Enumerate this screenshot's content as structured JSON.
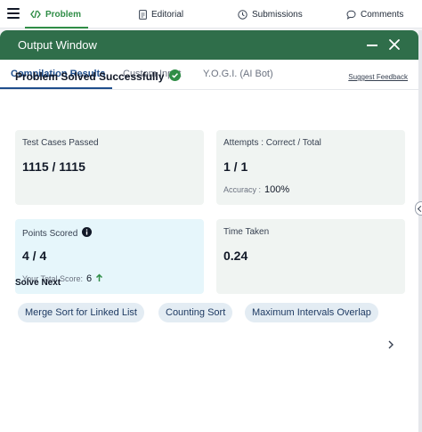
{
  "nav": {
    "tabs": [
      {
        "label": "Problem",
        "icon": "code-icon"
      },
      {
        "label": "Editorial",
        "icon": "document-icon"
      },
      {
        "label": "Submissions",
        "icon": "clock-icon"
      },
      {
        "label": "Comments",
        "icon": "comment-icon"
      }
    ]
  },
  "modal": {
    "title": "Output Window",
    "tabs": [
      "Compilation Results",
      "Custom Input",
      "Y.O.G.I. (AI Bot)"
    ],
    "status": "Problem Solved Successfully",
    "feedback_link": "Suggest Feedback",
    "cards": {
      "test_cases": {
        "label": "Test Cases Passed",
        "value": "1115 / 1115"
      },
      "attempts": {
        "label": "Attempts : Correct / Total",
        "value": "1 / 1",
        "sub_label": "Accuracy :",
        "sub_value": "100%"
      },
      "points": {
        "label": "Points Scored",
        "value": "4 / 4",
        "sub_label": "Your Total Score:",
        "sub_value": "6"
      },
      "time": {
        "label": "Time Taken",
        "value": "0.24"
      }
    },
    "solve_next": {
      "heading": "Solve Next",
      "chips": [
        "Merge Sort for Linked List",
        "Counting Sort",
        "Maximum Intervals Overlap"
      ]
    }
  },
  "colors": {
    "brand_green": "#2f8d46",
    "header_green": "#2f6e4a",
    "active_tab_blue": "#1f4e8c"
  }
}
